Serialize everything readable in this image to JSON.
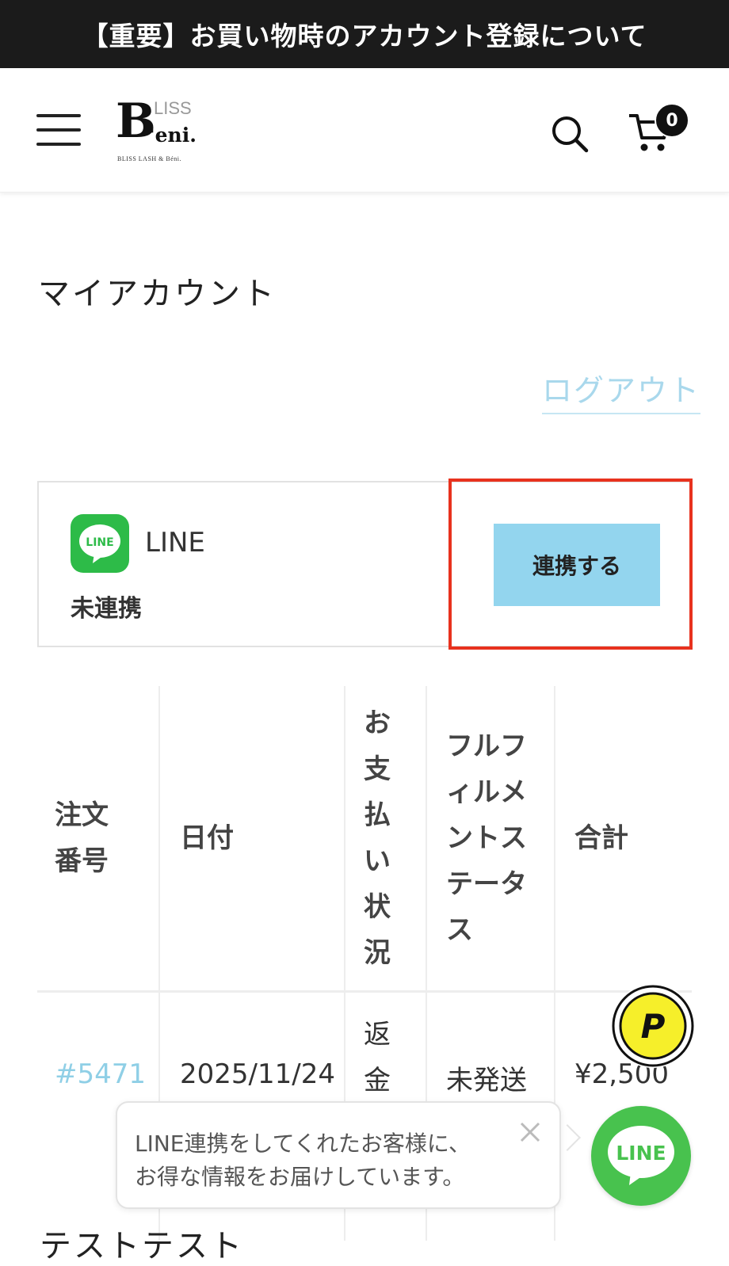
{
  "announcement": "【重要】お買い物時のアカウント登録について",
  "header": {
    "logo": {
      "b": "B",
      "liss": "LISS",
      "eni": "'eni.",
      "sub": "BLISS LASH & Béni."
    },
    "cart_count": "0"
  },
  "page": {
    "title": "マイアカウント",
    "logout_label": "ログアウト"
  },
  "line_card": {
    "name": "LINE",
    "icon_text": "LINE",
    "status": "未連携",
    "connect_button": "連携する"
  },
  "orders": {
    "headers": [
      "注文\n番号",
      "日付",
      "お\n支\n払\nい\n状\n況",
      "フルフ\nィルメ\nントス\nテータ\nス",
      "合計"
    ],
    "rows": [
      {
        "number": "#5471",
        "date": "2025/11/24",
        "payment": [
          "返",
          "金"
        ],
        "fulfillment": "未発送",
        "total": "¥2,500"
      }
    ]
  },
  "floating": {
    "points_label": "P",
    "tooltip_line1": "LINE連携をしてくれたお客様に、",
    "tooltip_line2": "お得な情報をお届けしています。",
    "line_label": "LINE"
  },
  "bottom_text": "テストテスト",
  "colors": {
    "announce_bg": "#1b1b1b",
    "logout": "#a9d8ec",
    "connect_button": "#93d5ee",
    "highlight": "#e8321e",
    "line_green": "#48c24e",
    "order_link": "#8fcfe6"
  }
}
